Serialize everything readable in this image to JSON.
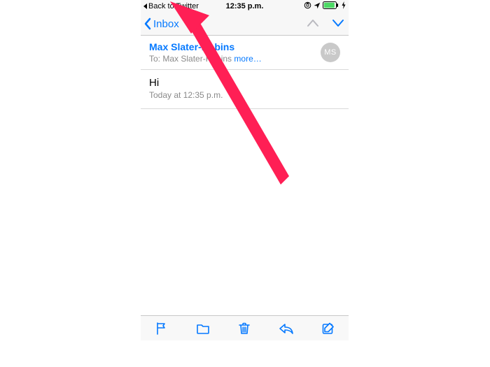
{
  "status_bar": {
    "back_to_app_label": "Back to Twitter",
    "time": "12:35 p.m."
  },
  "nav": {
    "back_label": "Inbox"
  },
  "email": {
    "sender_name": "Max Slater-Robins",
    "avatar_initials": "MS",
    "to_label": "To:",
    "to_recipient": "Max Slater-Robins",
    "more_label": "more…",
    "subject": "Hi",
    "date_line": "Today at 12:35 p.m."
  },
  "colors": {
    "ios_blue": "#0579ff",
    "arrow_red": "#ff2d55",
    "battery_green": "#4cd964",
    "muted_gray": "#8a8a8a"
  }
}
